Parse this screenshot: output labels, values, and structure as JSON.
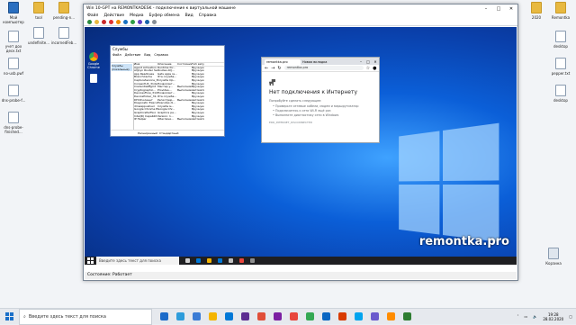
{
  "host_desktop": {
    "left_icons": [
      {
        "label": "Мой компьютер",
        "kind": "pc"
      },
      {
        "label": "учет дох деск.txt",
        "kind": "doc"
      },
      {
        "label": "no-usb.pwf",
        "kind": "doc"
      },
      {
        "label": "dns-probe-f...",
        "kind": "doc"
      },
      {
        "label": "dns-probe-finished...",
        "kind": "doc"
      }
    ],
    "top_icons": [
      {
        "label": "tool",
        "kind": "folder"
      },
      {
        "label": "pending-n...",
        "kind": "folder"
      },
      {
        "label": "pending",
        "kind": "folder"
      },
      {
        "label": "to-go",
        "kind": "folder"
      },
      {
        "label": "undefinite...",
        "kind": "doc"
      },
      {
        "label": "incornedFeb...",
        "kind": "doc"
      },
      {
        "label": "изменить...",
        "kind": "doc"
      }
    ],
    "right_icons": [
      {
        "label": "2020",
        "kind": "folder"
      },
      {
        "label": "Remontka",
        "kind": "folder"
      },
      {
        "label": "desktop",
        "kind": "doc"
      },
      {
        "label": "pepper.txt",
        "kind": "doc"
      },
      {
        "label": "desktop",
        "kind": "doc"
      },
      {
        "label": "Корзина",
        "kind": "bin"
      }
    ]
  },
  "vm_window": {
    "title": "Win 10-GPT на REMONTKADESK - подключение к виртуальной машине",
    "menu": [
      "Файл",
      "Действие",
      "Медиа",
      "Буфер обмена",
      "Вид",
      "Справка"
    ],
    "status": "Состояние: Работает",
    "controls": [
      "–",
      "□",
      "✕"
    ]
  },
  "guest": {
    "icons": [
      {
        "label": "Google Chrome",
        "color": "#e8453c"
      },
      {
        "label": "",
        "color": "#ffffff"
      }
    ],
    "watermark": "remontka.pro",
    "taskbar": {
      "search": "Введите здесь текст для поиска",
      "clock": ""
    }
  },
  "services_window": {
    "title": "Службы",
    "menu": [
      "Файл",
      "Действие",
      "Вид",
      "Справка"
    ],
    "tree_item": "Службы (локальные)",
    "headers": [
      "Имя",
      "Описание",
      "Состояние",
      "Тип запуска"
    ],
    "rows": [
      [
        "Agent Activation R...",
        "Runtime for...",
        "",
        "Вручную"
      ],
      [
        "AllJoyn Router Se...",
        "Routes AllJ...",
        "",
        "Вручную"
      ],
      [
        "App Readiness",
        "Gets apps re...",
        "",
        "Вручную"
      ],
      [
        "BranchCache",
        "Эта служба...",
        "",
        "Вручную"
      ],
      [
        "CaptureService_31...",
        "Служба Op...",
        "",
        "Вручную"
      ],
      [
        "ConsentUX_31da3",
        "Позволяет...",
        "",
        "Вручную"
      ],
      [
        "CredentialMgmt",
        "Мастер у...",
        "Выполняется",
        "Вручную"
      ],
      [
        "Cryptographic...",
        "Provides...",
        "Выполняется",
        "Автоматически"
      ],
      [
        "DevicesFlow_31d...",
        "Позволяет...",
        "",
        "Вручную"
      ],
      [
        "DevicePicker_31...",
        "Эта служба...",
        "",
        "Вручную"
      ],
      [
        "DHCP-клиент",
        "Регистрир...",
        "Выполняется",
        "Автоматически"
      ],
      [
        "Diagnostic Execut...",
        "Executes di...",
        "",
        "Вручную"
      ],
      [
        "dmwappushsvc",
        "Служба м...",
        "",
        "Вручную"
      ],
      [
        "Google Chrome El...",
        "Google Chr...",
        "",
        "Вручную"
      ],
      [
        "GraphicsPerfSvc",
        "Graphics pe...",
        "",
        "Вручную"
      ],
      [
        "Intel(R) Capabilit...",
        "Version: 1...",
        "",
        "Вручную"
      ],
      [
        "IP Helper",
        "Обеспечи...",
        "Выполняется",
        "Автоматически"
      ]
    ],
    "tabs": [
      "Расширенный",
      "Стандартный"
    ]
  },
  "chrome_window": {
    "tabs": [
      "remontka.pro",
      "Новая вкладка"
    ],
    "address": "remontka.pro",
    "heading": "Нет подключения к Интернету",
    "hint": "Попробуйте сделать следующее:",
    "bullets": [
      "Проверьте сетевые кабели, модем и маршрутизатор",
      "Подключитесь к сети Wi-Fi ещё раз",
      "Выполните диагностику сети в Windows"
    ],
    "error_code": "ERR_INTERNET_DISCONNECTED"
  },
  "host_taskbar": {
    "search": "Введите здесь текст для поиска",
    "clock_time": "19:28",
    "clock_date": "28.02.2020",
    "app_colors": [
      "#1b6ac9",
      "#2d9cdb",
      "#3a7bd5",
      "#f4b400",
      "#0078d7",
      "#5c2d91",
      "#e04e39",
      "#7b1fa2",
      "#e8453c",
      "#34a853",
      "#0a66c2",
      "#d83b01",
      "#00a4ef",
      "#6a5acd",
      "#ff8c00",
      "#2e7d32"
    ]
  }
}
